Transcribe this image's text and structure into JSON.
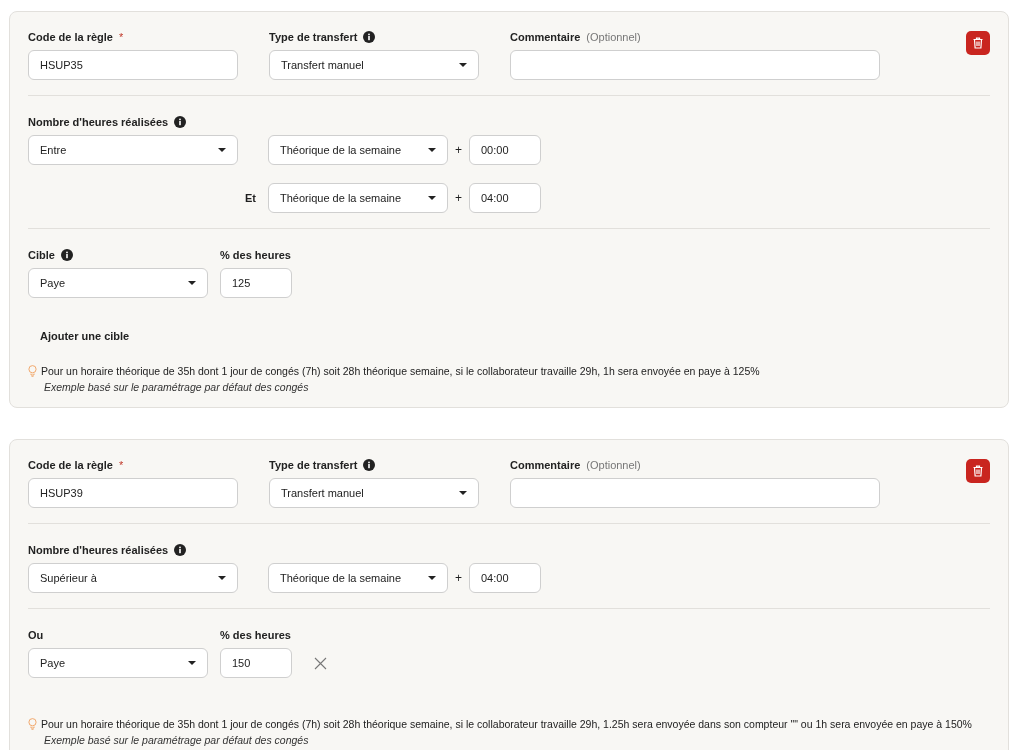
{
  "rules": [
    {
      "code_label": "Code de la règle",
      "required_mark": "*",
      "code": "HSUP35",
      "transfer_label": "Type de transfert",
      "transfer_value": "Transfert manuel",
      "comment_label": "Commentaire",
      "comment_optional": "(Optionnel)",
      "hours_label": "Nombre d'heures réalisées",
      "conditions": [
        {
          "kind": "operator",
          "operator": "Entre",
          "base": "Théorique de la semaine",
          "plus": "+",
          "offset": "00:00"
        },
        {
          "kind": "connector",
          "connector": "Et",
          "base": "Théorique de la semaine",
          "plus": "+",
          "offset": "04:00"
        }
      ],
      "target_label": "Cible",
      "target_info": true,
      "percent_label": "% des heures",
      "targets": [
        {
          "target": "Paye",
          "percent": "125",
          "removable": false
        }
      ],
      "add_target": "Ajouter une cible",
      "hint": "Pour un horaire théorique de 35h dont 1 jour de congés (7h) soit 28h théorique semaine, si le collaborateur travaille 29h, 1h sera envoyée en paye à 125%",
      "hint_note": "Exemple basé sur le paramétrage par défaut des congés"
    },
    {
      "code_label": "Code de la règle",
      "required_mark": "*",
      "code": "HSUP39",
      "transfer_label": "Type de transfert",
      "transfer_value": "Transfert manuel",
      "comment_label": "Commentaire",
      "comment_optional": "(Optionnel)",
      "hours_label": "Nombre d'heures réalisées",
      "conditions": [
        {
          "kind": "operator",
          "operator": "Supérieur à",
          "base": "Théorique de la semaine",
          "plus": "+",
          "offset": "04:00"
        }
      ],
      "target_label": "Ou",
      "target_info": false,
      "percent_label": "% des heures",
      "targets": [
        {
          "target": "Paye",
          "percent": "150",
          "removable": true
        }
      ],
      "hint": "Pour un horaire théorique de 35h dont 1 jour de congés (7h) soit 28h théorique semaine, si le collaborateur travaille 29h, 1.25h sera envoyée dans son compteur \"\" ou 1h sera envoyée en paye à 150%",
      "hint_note": "Exemple basé sur le paramétrage par défaut des congés"
    }
  ]
}
